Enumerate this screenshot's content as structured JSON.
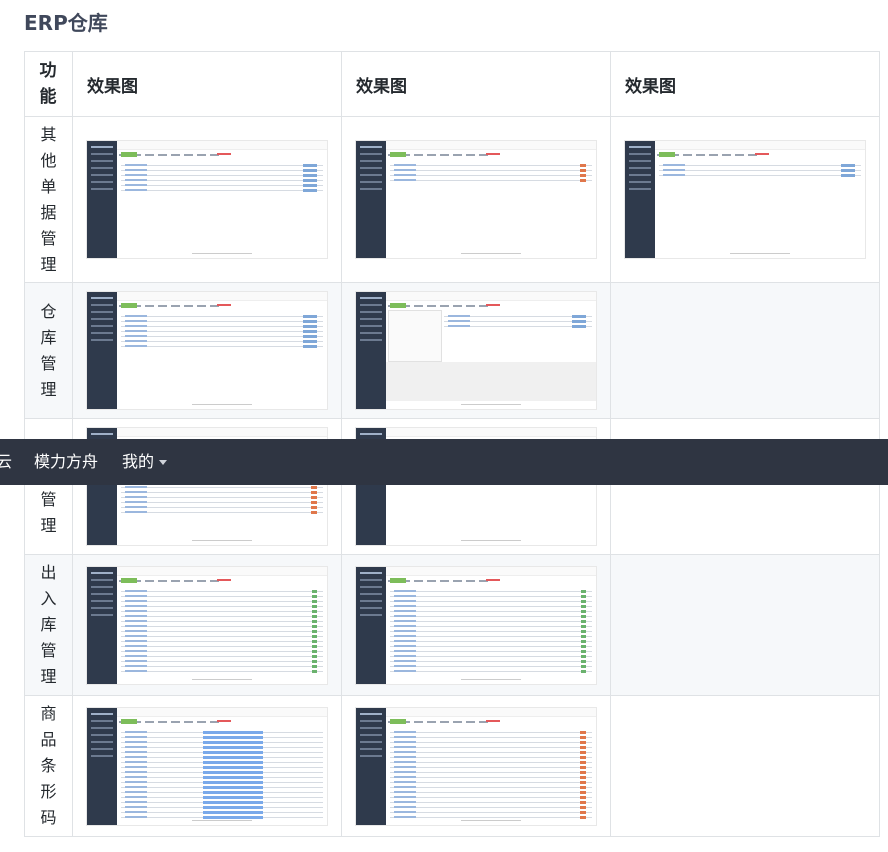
{
  "section_title": "ERP仓库",
  "table": {
    "headers": {
      "func": "功能",
      "img1": "效果图",
      "img2": "效果图",
      "img3": "效果图"
    },
    "rows": [
      {
        "func": "其他单据管理",
        "images": [
          "list",
          "list-orange",
          "list-small"
        ]
      },
      {
        "func": "仓库管理",
        "images": [
          "list",
          "detail"
        ]
      },
      {
        "func": "库存管理",
        "images": [
          "list-orange",
          "list-orange"
        ]
      },
      {
        "func": "出入库管理",
        "images": [
          "list-green",
          "list-green"
        ]
      },
      {
        "func": "商品条形码",
        "images": [
          "list-bars",
          "list-orange"
        ]
      }
    ]
  },
  "overlay_nav": {
    "items": [
      "云",
      "模力方舟",
      "我的"
    ],
    "dropdown_icon": "caret-down-icon"
  }
}
